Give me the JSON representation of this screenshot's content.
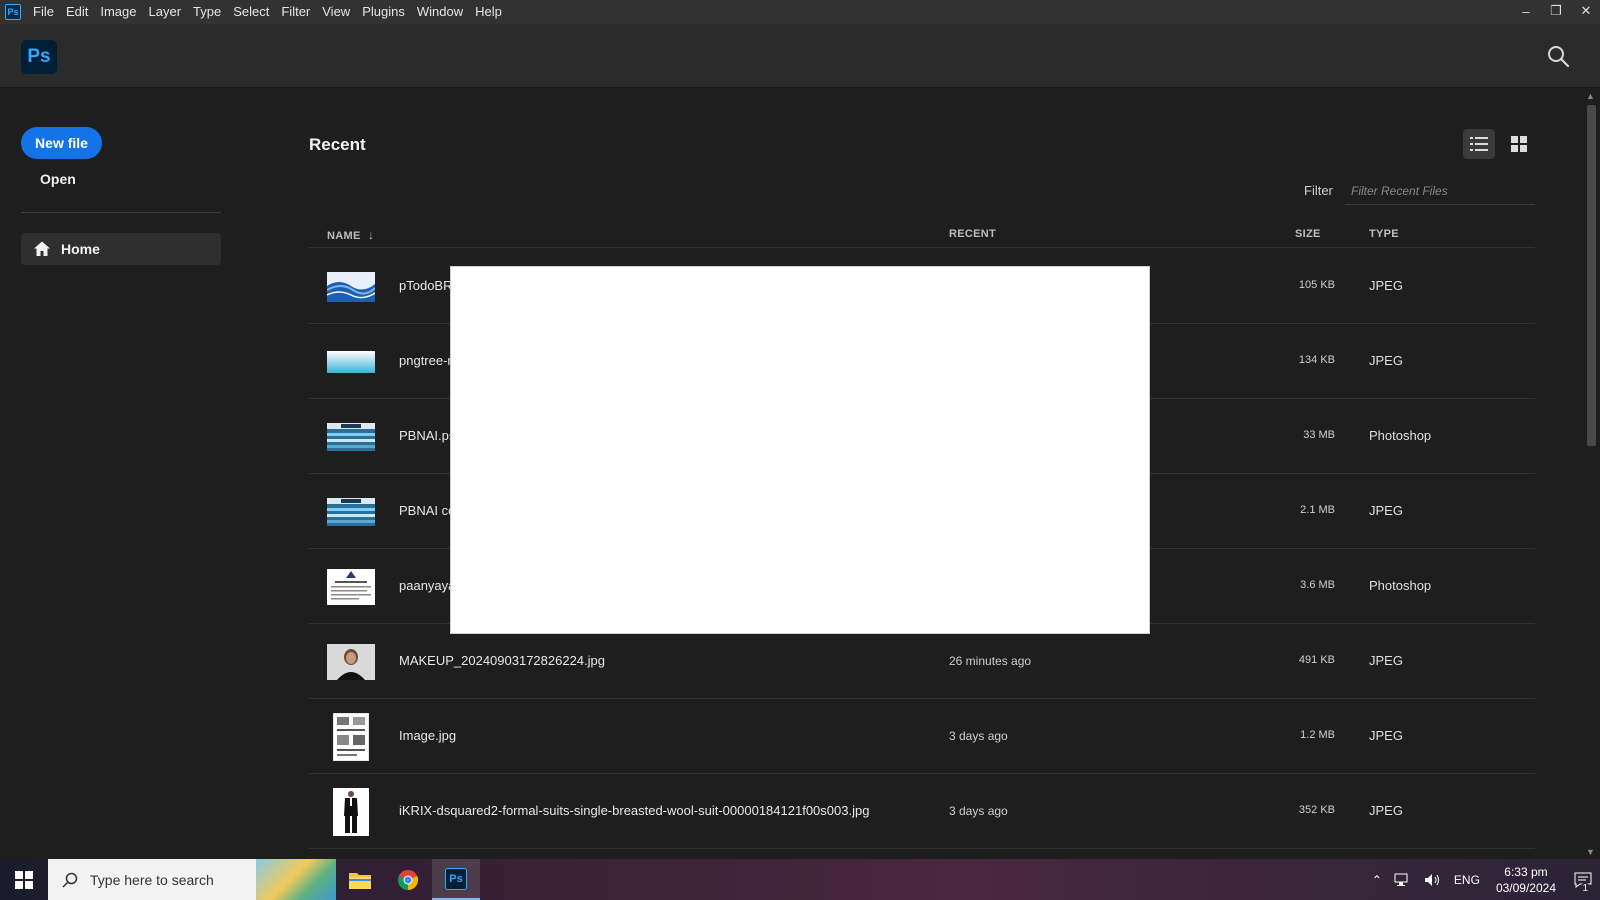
{
  "menubar": {
    "app_icon": "Ps",
    "items": [
      "File",
      "Edit",
      "Image",
      "Layer",
      "Type",
      "Select",
      "Filter",
      "View",
      "Plugins",
      "Window",
      "Help"
    ],
    "controls": {
      "minimize": "–",
      "restore": "❐",
      "close": "✕"
    }
  },
  "header": {
    "logo": "Ps",
    "search_icon": "search-icon"
  },
  "sidebar": {
    "new_file": "New file",
    "open": "Open",
    "home": "Home"
  },
  "main": {
    "title": "Recent",
    "filter_label": "Filter",
    "filter_placeholder": "Filter Recent Files",
    "columns": {
      "name": "NAME",
      "sort_arrow": "↓",
      "recent": "RECENT",
      "size": "SIZE",
      "type": "TYPE"
    },
    "files": [
      {
        "name": "pTodoBR",
        "recent": "",
        "size": "105 KB",
        "type": "JPEG",
        "thumb": "wave"
      },
      {
        "name": "pngtree-r",
        "recent": "",
        "size": "134 KB",
        "type": "JPEG",
        "thumb": "sky"
      },
      {
        "name": "PBNAI.ps",
        "recent": "",
        "size": "33 MB",
        "type": "Photoshop",
        "thumb": "banner"
      },
      {
        "name": "PBNAI co",
        "recent": "",
        "size": "2.1 MB",
        "type": "JPEG",
        "thumb": "banner"
      },
      {
        "name": "paanyaya",
        "recent": "",
        "size": "3.6 MB",
        "type": "Photoshop",
        "thumb": "doc"
      },
      {
        "name": "MAKEUP_20240903172826224.jpg",
        "recent": "26 minutes ago",
        "size": "491 KB",
        "type": "JPEG",
        "thumb": "portrait"
      },
      {
        "name": "Image.jpg",
        "recent": "3 days ago",
        "size": "1.2 MB",
        "type": "JPEG",
        "thumb": "sheet"
      },
      {
        "name": "iKRIX-dsquared2-formal-suits-single-breasted-wool-suit-00000184121f00s003.jpg",
        "recent": "3 days ago",
        "size": "352 KB",
        "type": "JPEG",
        "thumb": "suit"
      }
    ]
  },
  "taskbar": {
    "search_placeholder": "Type here to search",
    "language": "ENG",
    "time": "6:33 pm",
    "date": "03/09/2024",
    "notification_count": "1"
  }
}
